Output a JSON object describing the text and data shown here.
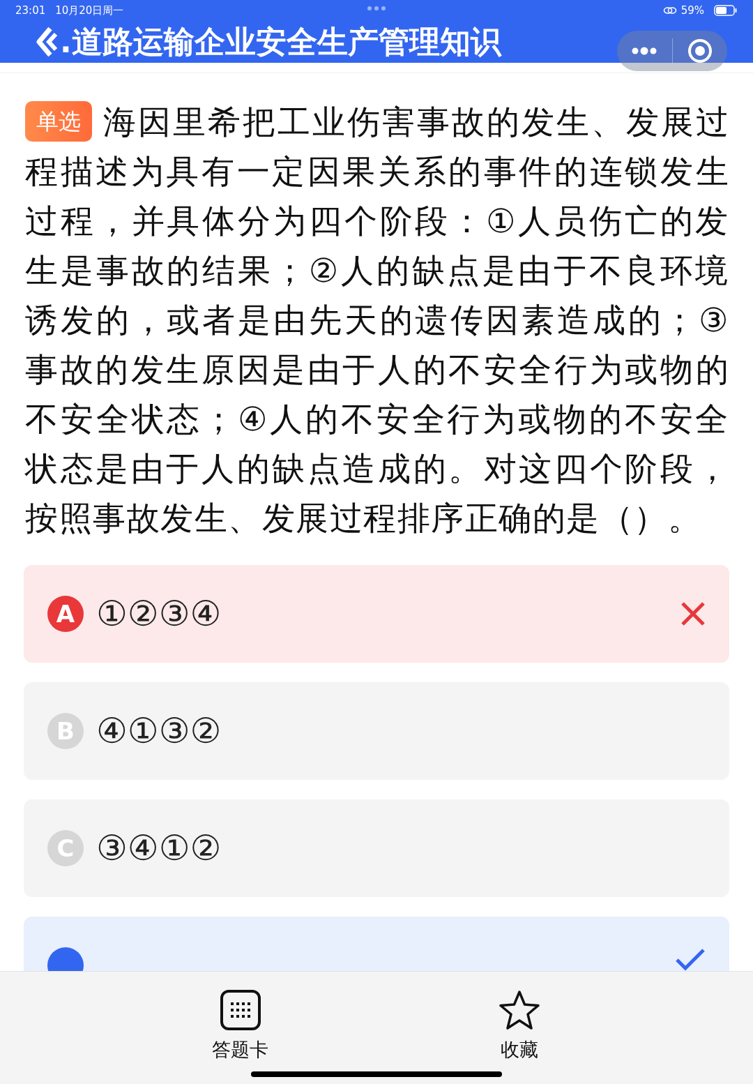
{
  "status_bar": {
    "time": "23:01",
    "date": "10月20日周一",
    "battery": "59%"
  },
  "header": {
    "title": ".道路运输企业安全生产管理知识"
  },
  "question": {
    "type_tag": "单选",
    "text": "海因里希把工业伤害事故的发生、发展过程描述为具有一定因果关系的事件的连锁发生过程，并具体分为四个阶段：①人员伤亡的发生是事故的结果；②人的缺点是由于不良环境诱发的，或者是由先天的遗传因素造成的；③事故的发生原因是由于人的不安全行为或物的不安全状态；④人的不安全行为或物的不安全状态是由于人的缺点造成的。对这四个阶段，按照事故发生、发展过程排序正确的是（）。"
  },
  "options": [
    {
      "letter": "A",
      "text": "①②③④",
      "selected": true,
      "correct": false
    },
    {
      "letter": "B",
      "text": "④①③②",
      "selected": false,
      "correct": false
    },
    {
      "letter": "C",
      "text": "③④①②",
      "selected": false,
      "correct": false
    },
    {
      "selected": false,
      "correct": true
    }
  ],
  "bottom_bar": {
    "items": [
      {
        "kind": "card",
        "label": "答题卡"
      },
      {
        "kind": "favorite",
        "label": "收藏"
      }
    ]
  }
}
